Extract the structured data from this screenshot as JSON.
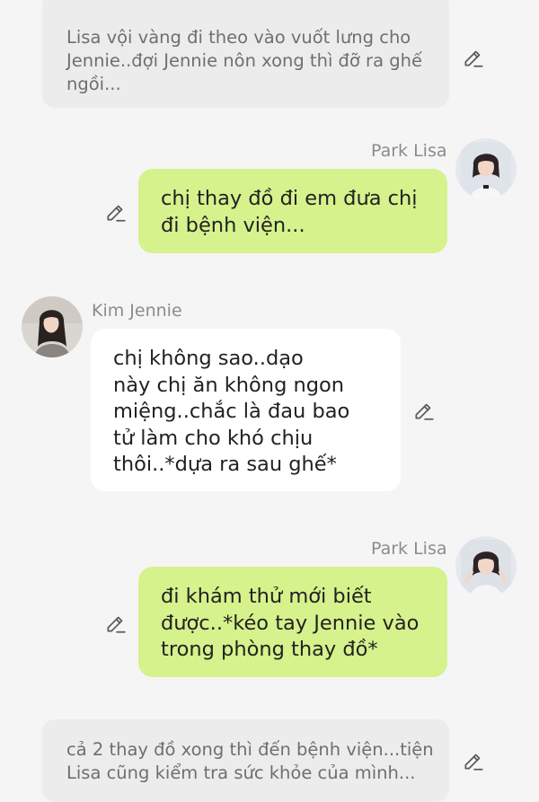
{
  "colors": {
    "background": "#f5f5f5",
    "narration_bg": "#ececec",
    "narration_text": "#6f6f6f",
    "user_bubble": "#d6f28c",
    "other_bubble": "#ffffff",
    "name_text": "#8c8c8c",
    "icon": "#5a5a5a"
  },
  "messages": [
    {
      "type": "narration",
      "lines": [
        "Lisa vội vàng đi theo vào vuốt lưng cho",
        "Jennie..đợi Jennie nôn xong thì đỡ ra ghế",
        "ngồi..."
      ],
      "icon": "pencil-icon"
    },
    {
      "type": "sent",
      "sender": "Park Lisa",
      "lines": [
        "chị thay đồ đi em đưa chị",
        "đi bệnh viện..."
      ],
      "icon": "pencil-icon"
    },
    {
      "type": "received",
      "sender": "Kim Jennie",
      "lines": [
        "chị không sao..dạo",
        "này chị ăn không ngon",
        "miệng..chắc là đau bao",
        "tử làm cho khó chịu",
        "thôi..*dựa ra sau ghế*"
      ],
      "icon": "pencil-icon"
    },
    {
      "type": "sent",
      "sender": "Park Lisa",
      "lines": [
        "đi khám thử mới biết",
        "được..*kéo tay Jennie vào",
        "trong phòng thay đồ*"
      ],
      "icon": "pencil-icon"
    },
    {
      "type": "narration",
      "lines": [
        "cả 2 thay đồ xong thì đến bệnh viện...tiện",
        "Lisa cũng kiểm tra sức khỏe của mình..."
      ],
      "icon": "pencil-icon"
    }
  ]
}
